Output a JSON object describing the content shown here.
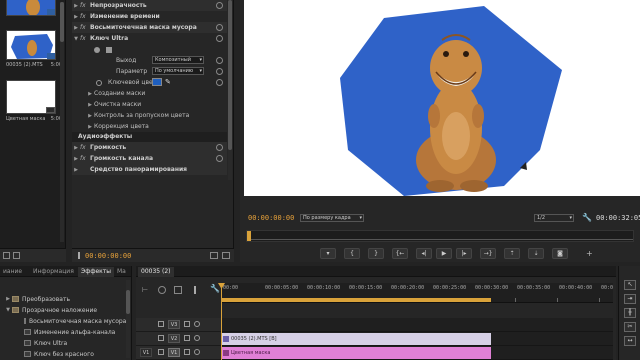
{
  "project_panel": {
    "items": [
      {
        "name": "",
        "duration": ""
      },
      {
        "name": "00035 (2).MTS",
        "duration": "5:00"
      },
      {
        "name": "Цветная маска",
        "duration": "5:00"
      }
    ]
  },
  "effect_controls": {
    "rows": [
      {
        "kind": "fx",
        "label": "Непрозрачность"
      },
      {
        "kind": "fx",
        "label": "Изменение времени"
      },
      {
        "kind": "fx",
        "label": "Восьмиточечная маска мусора"
      },
      {
        "kind": "fx",
        "label": "Ключ Ultra"
      }
    ],
    "output_label": "Выход",
    "output_value": "Композитный",
    "setting_label": "Параметр",
    "setting_value": "По умолчанию",
    "key_color_label": "Ключевой цвет",
    "key_color": "#1f5fbf",
    "subgroups": [
      "Создание маски",
      "Очистка маски",
      "Контроль за пропуском цвета",
      "Коррекция цвета"
    ],
    "audio_section": "Аудиоэффекты",
    "audio_rows": [
      "Громкость",
      "Громкость канала",
      "Средство панорамирования"
    ],
    "timecode": "00:00:00:00"
  },
  "program_monitor": {
    "timecode": "00:00:00:00",
    "fit": "По размеру кадра",
    "resolution": "1/2",
    "duration": "00:00:32:05",
    "key_color": "#2f62c8"
  },
  "browser": {
    "tabs": [
      "иание",
      "Информация",
      "Эффекты",
      "Ма"
    ],
    "active_tab": "Эффекты",
    "tree": [
      {
        "indent": 1,
        "kind": "folder",
        "label": "Преобразовать"
      },
      {
        "indent": 1,
        "kind": "folder",
        "label": "Прозрачное наложение"
      },
      {
        "indent": 2,
        "kind": "fx",
        "label": "Восьмиточечная маска мусора"
      },
      {
        "indent": 2,
        "kind": "fx",
        "label": "Изменение альфа-канала"
      },
      {
        "indent": 2,
        "kind": "fx",
        "label": "Ключ Ultra"
      },
      {
        "indent": 2,
        "kind": "fx",
        "label": "Ключ без красного"
      }
    ]
  },
  "timeline": {
    "tab": "00035 (2)",
    "timecode": "00:00:00:00",
    "ruler_labels": [
      "00:00",
      "00:00:05:00",
      "00:00:10:00",
      "00:00:15:00",
      "00:00:20:00",
      "00:00:25:00",
      "00:00:30:00",
      "00:00:35:00",
      "00:00:40:00",
      "00:00:45:00"
    ],
    "tracks": [
      {
        "label": "V3",
        "clip": null
      },
      {
        "label": "V2",
        "clip": {
          "name": "00035 (2).MTS [В]",
          "color": "#d6d0e6"
        }
      },
      {
        "label": "V1",
        "clip": {
          "name": "Цветная маска",
          "color": "#e080d6"
        }
      }
    ]
  }
}
